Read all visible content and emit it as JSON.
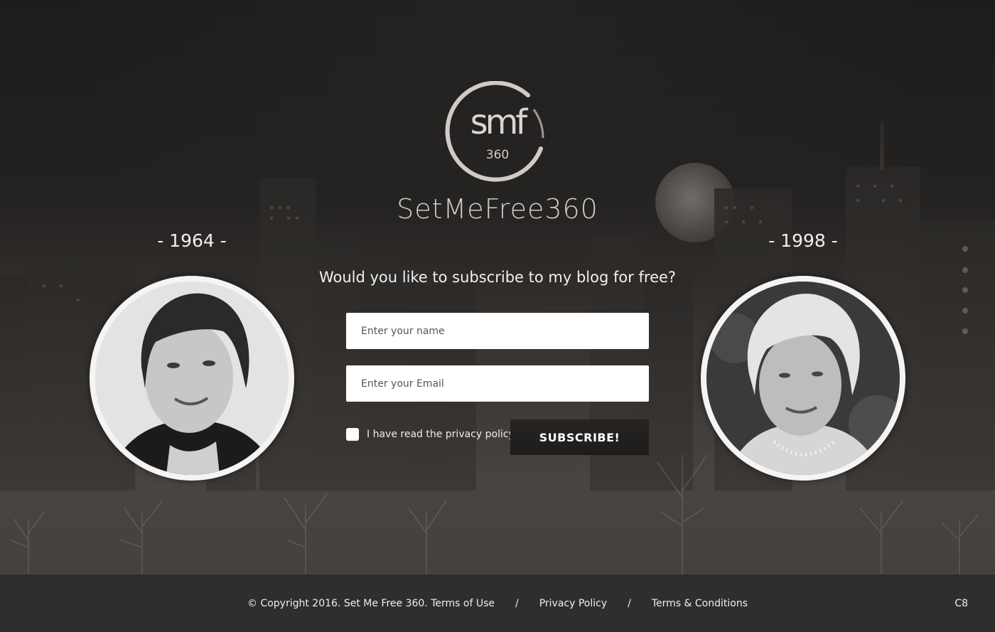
{
  "logo": {
    "monogram": "smf",
    "number": "360",
    "wordmark": "SetMeFree360"
  },
  "years": {
    "left": "- 1964 -",
    "right": "- 1998 -"
  },
  "subscribe_form": {
    "question": "Would you like to subscribe to my blog for free?",
    "name_placeholder": "Enter your name",
    "email_placeholder": "Enter your Email",
    "privacy_checkbox_label": "I have read the privacy policy",
    "privacy_checked": false,
    "button_label": "SUBSCRIBE!"
  },
  "footer": {
    "copyright": "© Copyright 2016. Set Me Free 360. Terms of Use",
    "separator": "/",
    "privacy_link": "Privacy Policy",
    "terms_link": "Terms & Conditions",
    "badge": "C8"
  },
  "colors": {
    "footer_bg": "#2e2e2e",
    "button_bg": "#1f1e1d",
    "text": "#ffffff"
  }
}
